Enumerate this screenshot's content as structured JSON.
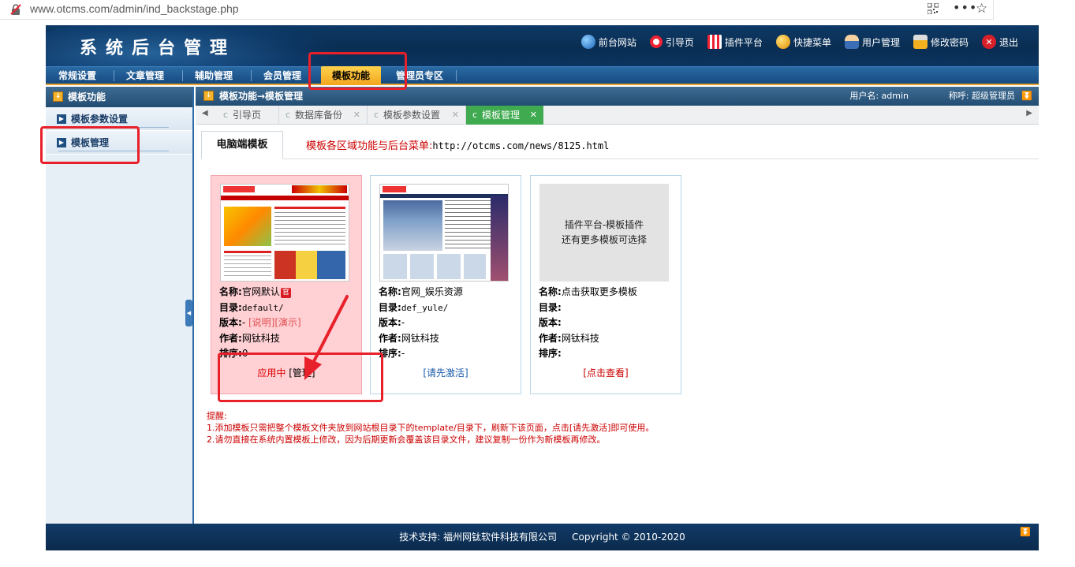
{
  "browser": {
    "url": "www.otcms.com/admin/ind_backstage.php",
    "more_glyph": "•••",
    "star_glyph": "☆"
  },
  "header": {
    "title": "系统后台管理",
    "links": [
      {
        "label": "前台网站",
        "icon": "globe-icon"
      },
      {
        "label": "引导页",
        "icon": "lifebuoy-icon"
      },
      {
        "label": "插件平台",
        "icon": "store-icon"
      },
      {
        "label": "快捷菜单",
        "icon": "star-ball-icon"
      },
      {
        "label": "用户管理",
        "icon": "user-icon"
      },
      {
        "label": "修改密码",
        "icon": "padlock-icon"
      },
      {
        "label": "退出",
        "icon": "exit-icon"
      }
    ]
  },
  "nav": {
    "items": [
      "常规设置",
      "文章管理",
      "辅助管理",
      "会员管理",
      "模板功能",
      "管理员专区"
    ],
    "active": "模板功能"
  },
  "sidebar": {
    "heading": "模板功能",
    "items": [
      "模板参数设置",
      "模板管理"
    ]
  },
  "crumb": {
    "path": "模板功能→模板管理",
    "username": "用户名: admin",
    "role": "称呼: 超级管理员"
  },
  "tabs": [
    {
      "label": "引导页",
      "closable": false
    },
    {
      "label": "数据库备份",
      "closable": true
    },
    {
      "label": "模板参数设置",
      "closable": true
    },
    {
      "label": "模板管理",
      "closable": true,
      "active": true
    }
  ],
  "subtab": {
    "label": "电脑端模板",
    "notice_label": "模板各区域功能与后台菜单:",
    "notice_url": "http://otcms.com/news/8125.html"
  },
  "cards": [
    {
      "name_key": "名称:",
      "name": "官网默认",
      "badge": "官",
      "dir_key": "目录:",
      "dir": "default/",
      "version_key": "版本:",
      "version": "-",
      "extra_links": "[说明][演示]",
      "author_key": "作者:",
      "author": "网钛科技",
      "order_key": "排序:",
      "order": "0",
      "status": "应用中",
      "action": "[管理]"
    },
    {
      "name_key": "名称:",
      "name": "官网_娱乐资源",
      "dir_key": "目录:",
      "dir": "def_yule/",
      "version_key": "版本:",
      "version": "-",
      "author_key": "作者:",
      "author": "网钛科技",
      "order_key": "排序:",
      "order": "-",
      "action": "[请先激活]"
    },
    {
      "thumb_line1": "插件平台-模板插件",
      "thumb_line2": "还有更多模板可选择",
      "name_key": "名称:",
      "name": "点击获取更多模板",
      "dir_key": "目录:",
      "dir": "",
      "version_key": "版本:",
      "version": "",
      "author_key": "作者:",
      "author": "网钛科技",
      "order_key": "排序:",
      "order": "",
      "action": "[点击查看]"
    }
  ],
  "reminders": {
    "title": "提醒:",
    "line1": "1.添加模板只需把整个模板文件夹放到网站根目录下的template/目录下，刷新下该页面，点击[请先激活]即可使用。",
    "line2": "2.请勿直接在系统内置模板上修改，因为后期更新会覆盖该目录文件，建议复制一份作为新模板再修改。"
  },
  "footer": {
    "support": "技术支持: 福州网钛软件科技有限公司",
    "copyright": "Copyright © 2010-2020"
  },
  "colors": {
    "annotation": "#e8202a",
    "active_tab": "#3faa4f",
    "nav_active": "#f2a51e",
    "link_red": "#c00000"
  }
}
